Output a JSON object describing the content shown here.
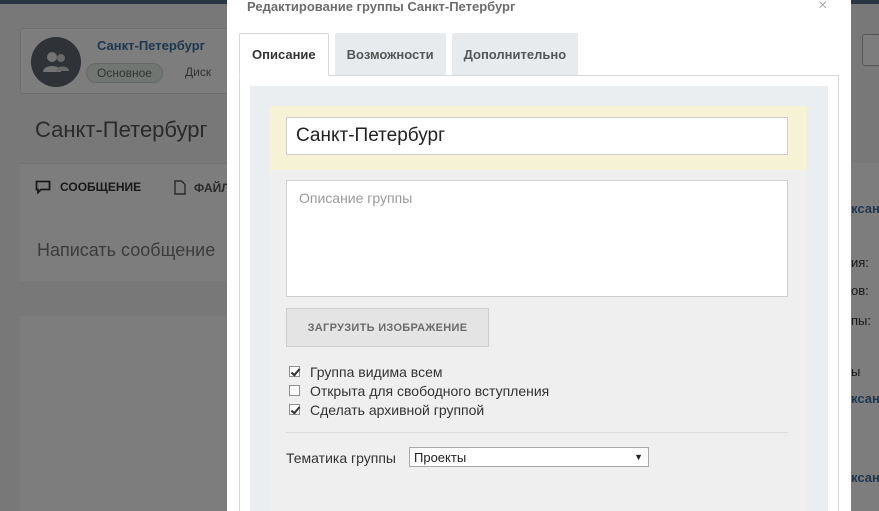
{
  "background": {
    "group_name": "Санкт-Петербург",
    "pill_label": "Основное",
    "disk_label": "Диск",
    "page_title": "Санкт-Петербург",
    "tab_message": "СООБЩЕНИЕ",
    "tab_files": "ФАЙЛ",
    "write_placeholder": "Написать сообщение",
    "right_texts": [
      "ксанд",
      "ия:",
      "ов:",
      "пы:",
      "ы",
      "ксанд",
      "ксанд"
    ]
  },
  "modal": {
    "title": "Редактирование группы Санкт-Петербург",
    "close_glyph": "×",
    "tabs": [
      {
        "label": "Описание",
        "active": true
      },
      {
        "label": "Возможности",
        "active": false
      },
      {
        "label": "Дополнительно",
        "active": false
      }
    ],
    "form": {
      "name_value": "Санкт-Петербург",
      "description_value": "",
      "description_placeholder": "Описание группы",
      "upload_label": "ЗАГРУЗИТЬ ИЗОБРАЖЕНИЕ",
      "checkboxes": [
        {
          "label": "Группа видима всем",
          "checked": true
        },
        {
          "label": "Открыта для свободного вступления",
          "checked": false
        },
        {
          "label": "Сделать архивной группой",
          "checked": true
        }
      ],
      "topic_label": "Тематика группы",
      "topic_selected": "Проекты"
    }
  },
  "colors": {
    "link_blue": "#3d6ea3",
    "name_strip_yellow": "#f5f2d6"
  }
}
